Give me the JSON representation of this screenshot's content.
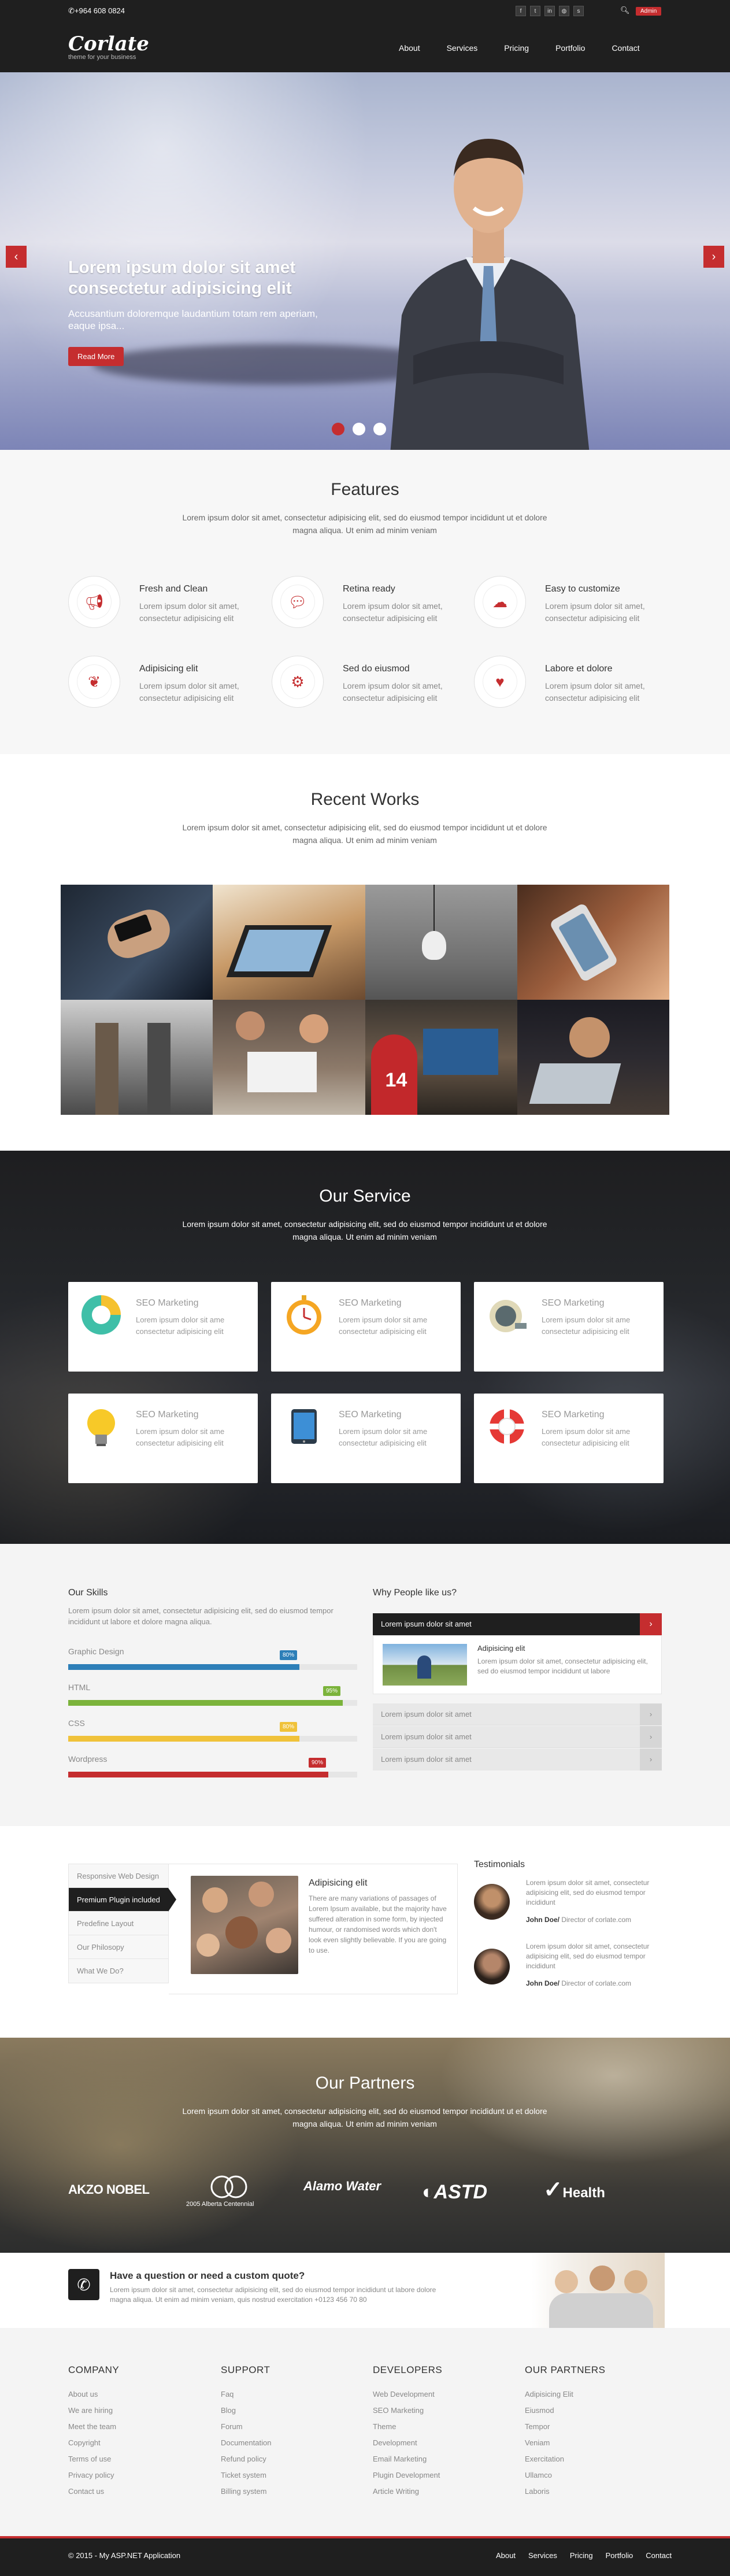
{
  "topbar": {
    "phone": "+964 608 0824",
    "logo": "Corlate",
    "tagline": "theme for your business",
    "admin_label": "Admin",
    "social_icons": [
      "facebook-icon",
      "twitter-icon",
      "linkedin-icon",
      "dribbble-icon",
      "skype-icon"
    ],
    "nav": [
      "About",
      "Services",
      "Pricing",
      "Portfolio",
      "Contact"
    ]
  },
  "hero": {
    "title": "Lorem ipsum dolor sit amet consectetur adipisicing elit",
    "subtitle": "Accusantium doloremque laudantium totam rem aperiam, eaque ipsa...",
    "button": "Read More",
    "slides": 3,
    "active_slide": 1
  },
  "features": {
    "title": "Features",
    "desc": "Lorem ipsum dolor sit amet, consectetur adipisicing elit, sed do eiusmod tempor incididunt ut et dolore magna aliqua. Ut enim ad minim veniam",
    "items": [
      {
        "title": "Fresh and Clean",
        "text": "Lorem ipsum dolor sit amet, consectetur adipisicing elit",
        "icon": "bullhorn-icon"
      },
      {
        "title": "Retina ready",
        "text": "Lorem ipsum dolor sit amet, consectetur adipisicing elit",
        "icon": "comments-icon"
      },
      {
        "title": "Easy to customize",
        "text": "Lorem ipsum dolor sit amet, consectetur adipisicing elit",
        "icon": "cloud-download-icon"
      },
      {
        "title": "Adipisicing elit",
        "text": "Lorem ipsum dolor sit amet, consectetur adipisicing elit",
        "icon": "leaf-icon"
      },
      {
        "title": "Sed do eiusmod",
        "text": "Lorem ipsum dolor sit amet, consectetur adipisicing elit",
        "icon": "cogs-icon"
      },
      {
        "title": "Labore et dolore",
        "text": "Lorem ipsum dolor sit amet, consectetur adipisicing elit",
        "icon": "heart-icon"
      }
    ]
  },
  "works": {
    "title": "Recent Works",
    "desc": "Lorem ipsum dolor sit amet, consectetur adipisicing elit, sed do eiusmod tempor incididunt ut et dolore magna aliqua. Ut enim ad minim veniam",
    "tiles": [
      "phone-hands",
      "tablet-desk",
      "lightbulb",
      "smartphone",
      "office-corridor",
      "students-laptop",
      "laptop-student",
      "laptop-night"
    ]
  },
  "services": {
    "title": "Our Service",
    "desc": "Lorem ipsum dolor sit amet, consectetur adipisicing elit, sed do eiusmod tempor incididunt ut et dolore magna aliqua. Ut enim ad minim veniam",
    "items": [
      {
        "title": "SEO Marketing",
        "text": "Lorem ipsum dolor sit ame consectetur adipisicing elit",
        "icon": "pie-chart-icon"
      },
      {
        "title": "SEO Marketing",
        "text": "Lorem ipsum dolor sit ame consectetur adipisicing elit",
        "icon": "stopwatch-icon"
      },
      {
        "title": "SEO Marketing",
        "text": "Lorem ipsum dolor sit ame consectetur adipisicing elit",
        "icon": "tape-measure-icon"
      },
      {
        "title": "SEO Marketing",
        "text": "Lorem ipsum dolor sit ame consectetur adipisicing elit",
        "icon": "lightbulb-icon"
      },
      {
        "title": "SEO Marketing",
        "text": "Lorem ipsum dolor sit ame consectetur adipisicing elit",
        "icon": "tablet-icon"
      },
      {
        "title": "SEO Marketing",
        "text": "Lorem ipsum dolor sit ame consectetur adipisicing elit",
        "icon": "lifebuoy-icon"
      }
    ]
  },
  "skills": {
    "title": "Our Skills",
    "desc": "Lorem ipsum dolor sit amet, consectetur adipisicing elit, sed do eiusmod tempor incididunt ut labore et dolore magna aliqua.",
    "bars": [
      {
        "label": "Graphic Design",
        "percent": "80%",
        "value": 0.8,
        "color": "#2d7fb8"
      },
      {
        "label": "HTML",
        "percent": "95%",
        "value": 0.95,
        "color": "#7bb33b"
      },
      {
        "label": "CSS",
        "percent": "80%",
        "value": 0.8,
        "color": "#f0c23a"
      },
      {
        "label": "Wordpress",
        "percent": "90%",
        "value": 0.9,
        "color": "#c52d2f"
      }
    ]
  },
  "why": {
    "title": "Why People like us?",
    "accordion_open": "Lorem ipsum dolor sit amet",
    "open_heading": "Adipisicing elit",
    "open_text": "Lorem ipsum dolor sit amet, consectetur adipisicing elit, sed do eiusmod tempor incididunt ut labore",
    "accordion_closed": [
      "Lorem ipsum dolor sit amet",
      "Lorem ipsum dolor sit amet",
      "Lorem ipsum dolor sit amet"
    ]
  },
  "tabs": {
    "items": [
      "Responsive Web Design",
      "Premium Plugin included",
      "Predefine Layout",
      "Our Philosopy",
      "What We Do?"
    ],
    "active": 1,
    "heading": "Adipisicing elit",
    "text": "There are many variations of passages of Lorem Ipsum available, but the majority have suffered alteration in some form, by injected humour, or randomised words which don't look even slightly believable. If you are going to use."
  },
  "testimonials": {
    "title": "Testimonials",
    "items": [
      {
        "text": "Lorem ipsum dolor sit amet, consectetur adipisicing elit, sed do eiusmod tempor incididunt",
        "name": "John Doe/",
        "role": " Director of corlate.com"
      },
      {
        "text": "Lorem ipsum dolor sit amet, consectetur adipisicing elit, sed do eiusmod tempor incididunt",
        "name": "John Doe/",
        "role": " Director of corlate.com"
      }
    ]
  },
  "partners": {
    "title": "Our Partners",
    "desc": "Lorem ipsum dolor sit amet, consectetur adipisicing elit, sed do eiusmod tempor incididunt ut et dolore magna aliqua. Ut enim ad minim veniam",
    "logos": [
      "AKZO NOBEL",
      "2005 Alberta Centennial",
      "Alamo Water",
      "ASTD",
      "Health"
    ]
  },
  "quote": {
    "title": "Have a question or need a custom quote?",
    "text": "Lorem ipsum dolor sit amet, consectetur adipisicing elit, sed do eiusmod tempor incididunt ut labore dolore magna aliqua. Ut enim ad minim veniam, quis nostrud exercitation +0123 456 70 80"
  },
  "footer": {
    "cols": [
      {
        "title": "COMPANY",
        "links": [
          "About us",
          "We are hiring",
          "Meet the team",
          "Copyright",
          "Terms of use",
          "Privacy policy",
          "Contact us"
        ]
      },
      {
        "title": "SUPPORT",
        "links": [
          "Faq",
          "Blog",
          "Forum",
          "Documentation",
          "Refund policy",
          "Ticket system",
          "Billing system"
        ]
      },
      {
        "title": "DEVELOPERS",
        "links": [
          "Web Development",
          "SEO Marketing",
          "Theme",
          "Development",
          "Email Marketing",
          "Plugin Development",
          "Article Writing"
        ]
      },
      {
        "title": "OUR PARTNERS",
        "links": [
          "Adipisicing Elit",
          "Eiusmod",
          "Tempor",
          "Veniam",
          "Exercitation",
          "Ullamco",
          "Laboris"
        ]
      }
    ],
    "copyright": "© 2015 - My ASP.NET Application",
    "nav": [
      "About",
      "Services",
      "Pricing",
      "Portfolio",
      "Contact"
    ]
  },
  "colors": {
    "accent": "#c52d2f",
    "dark": "#1f1f1f"
  }
}
